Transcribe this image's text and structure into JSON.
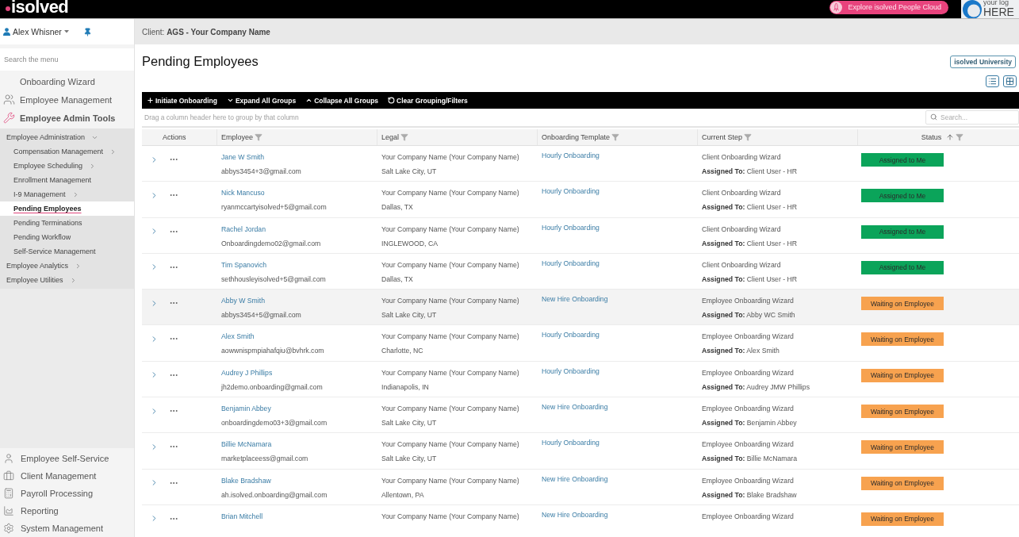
{
  "top_bar": {
    "logo": "isolved",
    "promo_button": "Explore isolved People Cloud",
    "custom_logo": [
      "your log",
      "HERE"
    ]
  },
  "sidebar": {
    "user": "Alex Whisner",
    "search": {
      "placeholder": "Search the menu"
    },
    "items": [
      {
        "label": "Onboarding Wizard",
        "selected": false
      },
      {
        "label": "Employee Management",
        "selected": false
      },
      {
        "label": "Employee Admin Tools",
        "selected": true,
        "children": [
          {
            "label": "Employee Administration",
            "selected": false,
            "expanded": true,
            "children": [
              {
                "label": "Compensation Management",
                "selected": false,
                "expanded": false
              },
              {
                "label": "Employee Scheduling",
                "selected": false,
                "expanded": false
              },
              {
                "label": "Enrollment Management",
                "selected": false
              },
              {
                "label": "I-9 Management",
                "selected": false,
                "expanded": false
              },
              {
                "label": "Pending Employees",
                "selected": true
              },
              {
                "label": "Pending Terminations",
                "selected": false
              },
              {
                "label": "Pending Workflow",
                "selected": false
              },
              {
                "label": "Self-Service Management",
                "selected": false
              }
            ]
          },
          {
            "label": "Employee Analytics",
            "selected": false,
            "expanded": false
          },
          {
            "label": "Employee Utilities",
            "selected": false,
            "expanded": false
          }
        ]
      }
    ],
    "bottom_items": [
      {
        "label": "Employee Self-Service"
      },
      {
        "label": "Client Management"
      },
      {
        "label": "Payroll Processing"
      },
      {
        "label": "Reporting"
      },
      {
        "label": "System Management"
      }
    ]
  },
  "header": {
    "client": "Client: **AGS - Your Company Name**"
  },
  "page": {
    "title": "Pending Employees",
    "help_button": "isolved University"
  },
  "toolbar": {
    "actions": [
      "Initiate Onboarding",
      "Expand All Groups",
      "Collapse All Groups",
      "Clear Grouping/Filters"
    ]
  },
  "grid": {
    "group_hint": "Drag a column header here to group by that column",
    "search": {
      "placeholder": "Search..."
    },
    "columns": [
      {
        "label": "Actions",
        "filter": false,
        "sorted": false
      },
      {
        "label": "Employee",
        "filter": true,
        "sorted": false
      },
      {
        "label": "Legal",
        "filter": true,
        "sorted": false
      },
      {
        "label": "Onboarding Template",
        "filter": true,
        "sorted": false
      },
      {
        "label": "Current Step",
        "filter": true,
        "sorted": false
      },
      {
        "label": "Status",
        "filter": true,
        "sorted": true
      }
    ],
    "rows": [
      {
        "employee": "Jane W Smith",
        "email": "abbys3454+3@gmail.com",
        "legal": "Your Company Name (Your Company Name)",
        "location": "Salt Lake City, UT",
        "template": "Hourly Onboarding",
        "step": "Client Onboarding Wizard",
        "assigned_to": "**Assigned To:** Client User - HR",
        "status": "Assigned to Me",
        "color": "#0ba45a",
        "highlighted": false
      },
      {
        "employee": "Nick Mancuso",
        "email": "ryanmccartyisolved+5@gmail.com",
        "legal": "Your Company Name (Your Company Name)",
        "location": "Dallas, TX",
        "template": "Hourly Onboarding",
        "step": "Client Onboarding Wizard",
        "assigned_to": "**Assigned To:** Client User - HR",
        "status": "Assigned to Me",
        "color": "#0ba45a",
        "highlighted": false
      },
      {
        "employee": "Rachel Jordan",
        "email": "Onboardingdemo02@gmail.com",
        "legal": "Your Company Name (Your Company Name)",
        "location": "INGLEWOOD, CA",
        "template": "Hourly Onboarding",
        "step": "Client Onboarding Wizard",
        "assigned_to": "**Assigned To:** Client User - HR",
        "status": "Assigned to Me",
        "color": "#0ba45a",
        "highlighted": false
      },
      {
        "employee": "Tim Spanovich",
        "email": "sethhousleyisolved+5@gmail.com",
        "legal": "Your Company Name (Your Company Name)",
        "location": "Dallas, TX",
        "template": "Hourly Onboarding",
        "step": "Client Onboarding Wizard",
        "assigned_to": "**Assigned To:** Client User - HR",
        "status": "Assigned to Me",
        "color": "#0ba45a",
        "highlighted": false
      },
      {
        "employee": "Abby W Smith",
        "email": "abbys3454+5@gmail.com",
        "legal": "Your Company Name (Your Company Name)",
        "location": "Salt Lake City, UT",
        "template": "New Hire Onboarding",
        "step": "Employee Onboarding Wizard",
        "assigned_to": "**Assigned To:** Abby WC Smith",
        "status": "Waiting on Employee",
        "color": "#f7a24f",
        "highlighted": true
      },
      {
        "employee": "Alex Smith",
        "email": "aowwnispmpiahafqiu@bvhrk.com",
        "legal": "Your Company Name (Your Company Name)",
        "location": "Charlotte, NC",
        "template": "Hourly Onboarding",
        "step": "Employee Onboarding Wizard",
        "assigned_to": "**Assigned To:** Alex Smith",
        "status": "Waiting on Employee",
        "color": "#f7a24f",
        "highlighted": false
      },
      {
        "employee": "Audrey J Phillips",
        "email": "jh2demo.onboarding@gmail.com",
        "legal": "Your Company Name (Your Company Name)",
        "location": "Indianapolis, IN",
        "template": "Hourly Onboarding",
        "step": "Employee Onboarding Wizard",
        "assigned_to": "**Assigned To:** Audrey JMW Phillips",
        "status": "Waiting on Employee",
        "color": "#f7a24f",
        "highlighted": false
      },
      {
        "employee": "Benjamin Abbey",
        "email": "onboardingdemo03+3@gmail.com",
        "legal": "Your Company Name (Your Company Name)",
        "location": "Salt Lake City, UT",
        "template": "New Hire Onboarding",
        "step": "Employee Onboarding Wizard",
        "assigned_to": "**Assigned To:** Benjamin Abbey",
        "status": "Waiting on Employee",
        "color": "#f7a24f",
        "highlighted": false
      },
      {
        "employee": "Billie McNamara",
        "email": "marketplaceess@gmail.com",
        "legal": "Your Company Name (Your Company Name)",
        "location": "Salt Lake City, UT",
        "template": "Hourly Onboarding",
        "step": "Employee Onboarding Wizard",
        "assigned_to": "**Assigned To:** Billie McNamara",
        "status": "Waiting on Employee",
        "color": "#f7a24f",
        "highlighted": false
      },
      {
        "employee": "Blake Bradshaw",
        "email": "ah.isolved.onboarding@gmail.com",
        "legal": "Your Company Name (Your Company Name)",
        "location": "Allentown, PA",
        "template": "New Hire Onboarding",
        "step": "Employee Onboarding Wizard",
        "assigned_to": "**Assigned To:** Blake Bradshaw",
        "status": "Waiting on Employee",
        "color": "#f7a24f",
        "highlighted": false
      },
      {
        "employee": "Brian Mitchell",
        "legal": "Your Company Name (Your Company Name)",
        "template": "New Hire Onboarding",
        "step": "Employee Onboarding Wizard",
        "status": "Waiting on Employee",
        "color": "#f7a24f",
        "highlighted": false
      }
    ]
  }
}
